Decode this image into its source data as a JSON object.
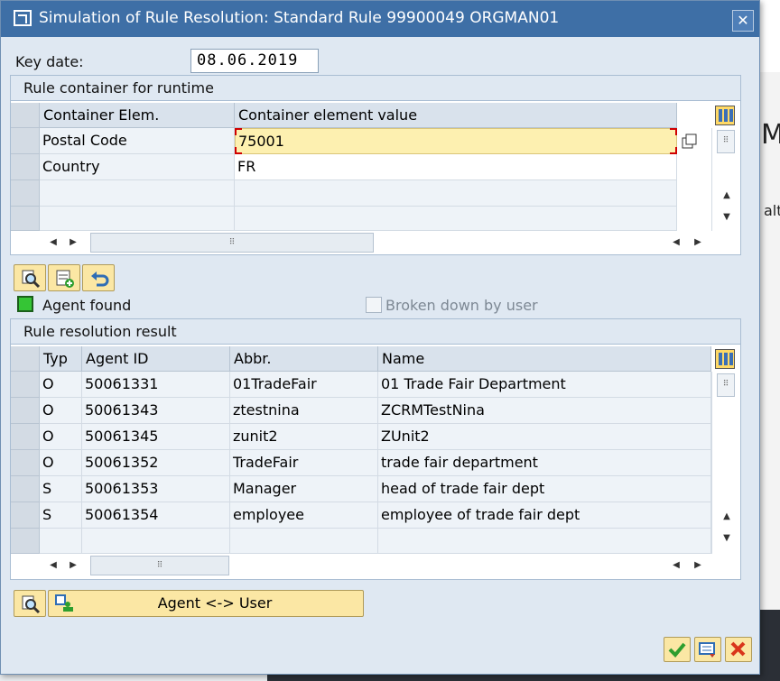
{
  "dialog": {
    "title": "Simulation of Rule Resolution: Standard Rule 99900049 ORGMAN01"
  },
  "key_date": {
    "label": "Key date:",
    "value": "08.06.2019"
  },
  "container_group": {
    "title": "Rule container for runtime",
    "columns": [
      "Container Elem.",
      "Container element value"
    ],
    "rows": [
      {
        "element": "Postal Code",
        "value": "75001"
      },
      {
        "element": "Country",
        "value": "FR"
      }
    ]
  },
  "status": {
    "agent_found": "Agent found",
    "broken_down": "Broken down by user",
    "agent_found_color": "#35c535"
  },
  "result_group": {
    "title": "Rule resolution result",
    "columns": [
      "Typ",
      "Agent ID",
      "Abbr.",
      "Name"
    ],
    "rows": [
      {
        "typ": "O",
        "agent_id": "50061331",
        "abbr": "01TradeFair",
        "name": "01 Trade Fair Department"
      },
      {
        "typ": "O",
        "agent_id": "50061343",
        "abbr": "ztestnina",
        "name": "ZCRMTestNina"
      },
      {
        "typ": "O",
        "agent_id": "50061345",
        "abbr": "zunit2",
        "name": "ZUnit2"
      },
      {
        "typ": "O",
        "agent_id": "50061352",
        "abbr": "TradeFair",
        "name": "trade fair department"
      },
      {
        "typ": "S",
        "agent_id": "50061353",
        "abbr": "Manager",
        "name": "head of trade fair dept"
      },
      {
        "typ": "S",
        "agent_id": "50061354",
        "abbr": "employee",
        "name": "employee of trade fair dept"
      }
    ]
  },
  "buttons": {
    "agent_user": "Agent <-> User"
  },
  "background": {
    "big_letter": "M",
    "partial_text": "alt"
  },
  "icons": {
    "title": "window-icon",
    "close": "close-icon",
    "column_settings": "column-settings-icon",
    "details": "magnifier-icon",
    "insert_row": "insert-row-icon",
    "undo": "undo-icon",
    "confirm": "checkmark-icon",
    "transfer": "transfer-icon",
    "cancel": "cancel-icon"
  }
}
